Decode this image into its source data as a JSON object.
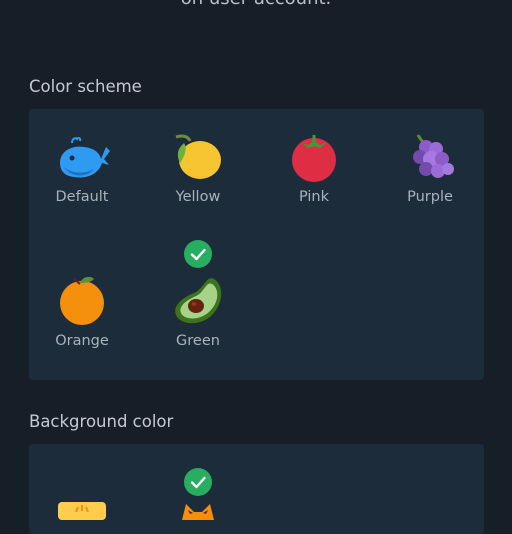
{
  "header": {
    "subtitle_tail": "on user account."
  },
  "color_scheme": {
    "title": "Color scheme",
    "selected": "Green",
    "options": [
      {
        "label": "Default",
        "icon": "whale-icon"
      },
      {
        "label": "Yellow",
        "icon": "lemon-icon"
      },
      {
        "label": "Pink",
        "icon": "tomato-icon"
      },
      {
        "label": "Purple",
        "icon": "grapes-icon"
      },
      {
        "label": "Orange",
        "icon": "tangerine-icon"
      },
      {
        "label": "Green",
        "icon": "avocado-icon"
      }
    ]
  },
  "background_color": {
    "title": "Background color",
    "selected_index": 1,
    "options": [
      {
        "icon": "sunrise-icon"
      },
      {
        "icon": "fox-icon"
      }
    ]
  },
  "colors": {
    "page_bg": "#161f28",
    "panel_bg": "#1c2c3b",
    "check": "#27ae60"
  }
}
